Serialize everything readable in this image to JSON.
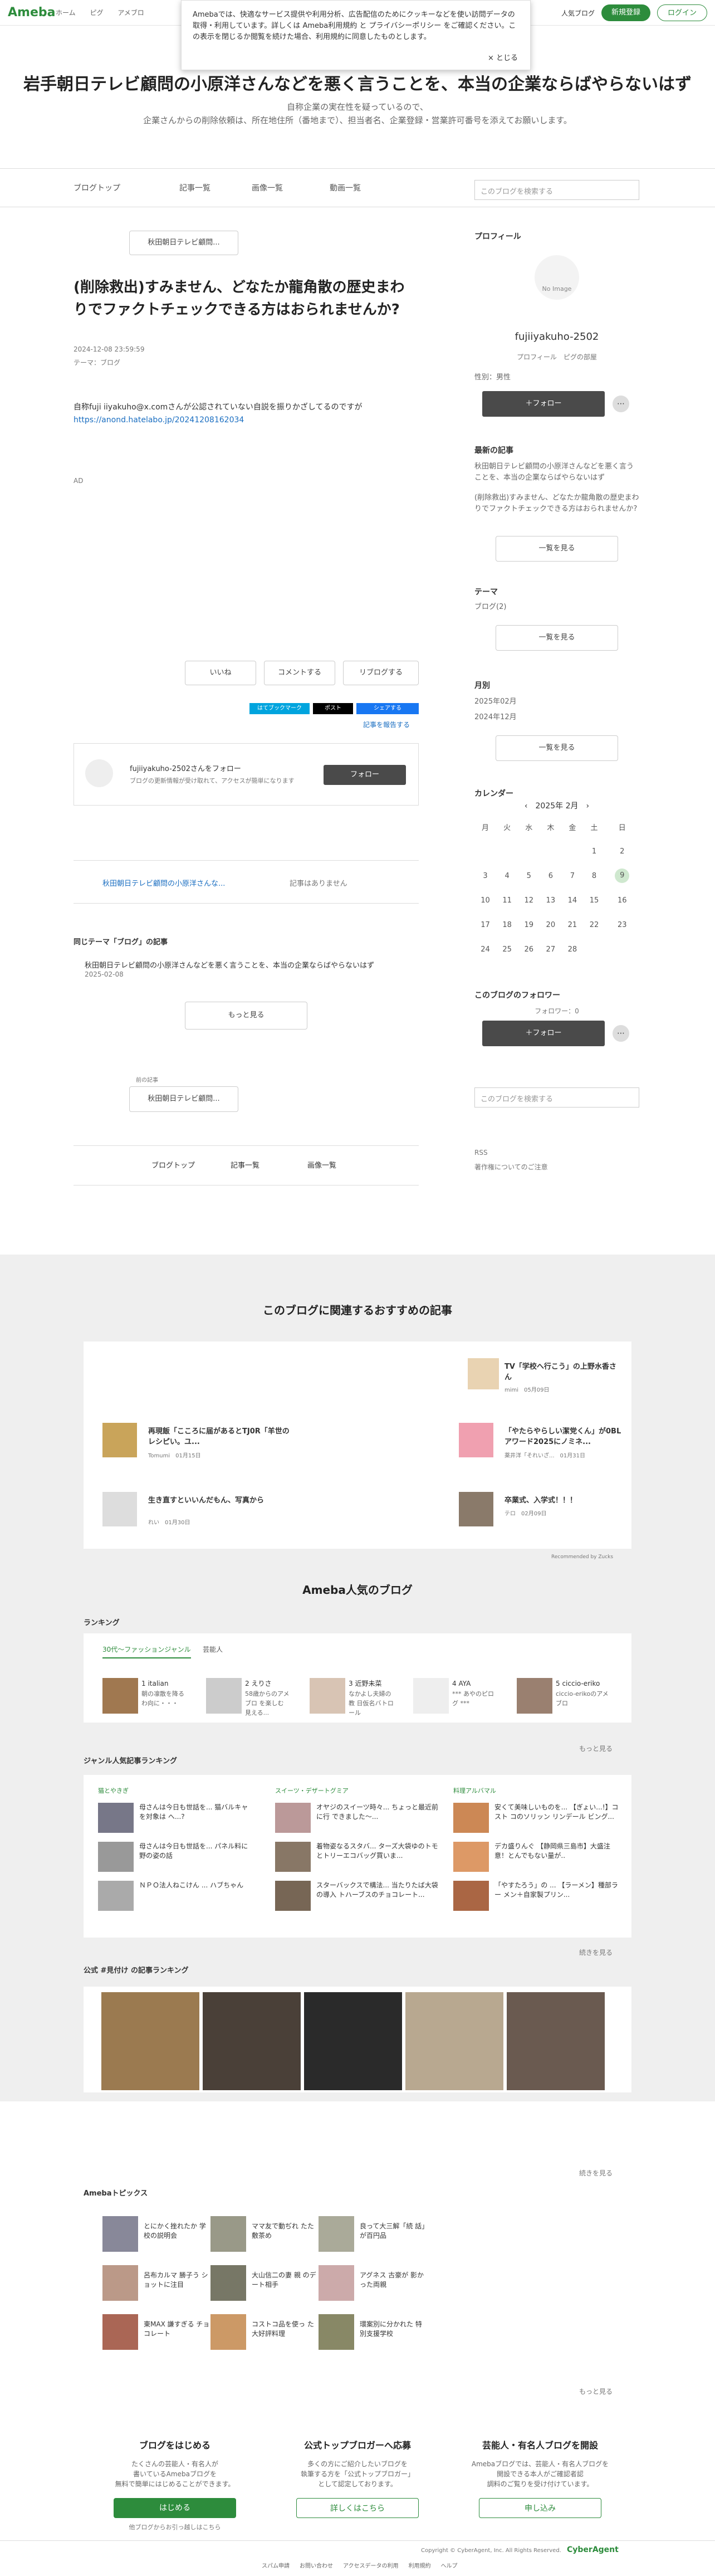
{
  "top": {
    "logo": "Ameba",
    "crumbs": [
      "ホーム",
      "ピグ",
      "アメブロ"
    ],
    "blog_btn": "人気ブログ",
    "register": "新規登録",
    "login": "ログイン"
  },
  "cookie": {
    "text": "Amebaでは、快適なサービス提供や利用分析、広告配信のためにクッキーなどを使い訪問データの取得・利用しています。詳しくは Ameba利用規約 と プライバシーポリシー をご確認ください。この表示を閉じるか閲覧を続けた場合、利用規約に同意したものとします。",
    "close": "× とじる"
  },
  "hero": {
    "title": "岩手朝日テレビ顧問の小原洋さんなどを悪く言うことを、本当の企業ならばやらないはず",
    "desc1": "自称企業の実在性を疑っているので、",
    "desc2": "企業さんからの削除依頼は、所在地住所（番地まで）、担当者名、企業登録・営業許可番号を添えてお願いします。"
  },
  "nav": {
    "tabs": [
      "ブログトップ",
      "記事一覧",
      "画像一覧",
      "動画一覧"
    ],
    "search_placeholder": "このブログを検索する"
  },
  "article": {
    "back": "秋田朝日テレビ顧問...",
    "title": "(削除救出)すみません、どなたか龍角散の歴史まわりでファクトチェックできる方はおられませんか?",
    "date": "2024-12-08 23:59:59",
    "theme": "テーマ：ブログ",
    "body1": "自称fuji iiyakuho@x.comさんが公認されていない自説を振りかざしてるのですが",
    "body2": "https://anond.hatelabo.jp/20241208162034",
    "ad": "AD",
    "like": "いいね",
    "comment": "コメントする",
    "reblog": "リブログする",
    "bookmark_label": "はてブックマーク",
    "post_label": "ポスト",
    "share_label": "シェアする",
    "report": "記事を報告する",
    "follow_name": "fujiiyakuho-2502さんをフォロー",
    "follow_desc": "ブログの更新情報が受け取れて、アクセスが簡単になります",
    "follow_btn": "フォロー",
    "prev": "秋田朝日テレビ顧問の小原洋さんな...",
    "next": "記事はありません",
    "same_theme": "同じテーマ「ブログ」の記事",
    "same_item": "秋田朝日テレビ顧問の小原洋さんなどを悪く言うことを、本当の企業ならばやらないはず",
    "same_date": "2025-02-08",
    "more": "もっと見る",
    "before_label": "前の記事",
    "before_btn": "秋田朝日テレビ顧問...",
    "bottom_tabs": [
      "ブログトップ",
      "記事一覧",
      "画像一覧"
    ]
  },
  "side": {
    "profile": "プロフィール",
    "noimage": "No Image",
    "name": "fujiiyakuho-2502",
    "links": "プロフィール　ピグの部屋",
    "gender": "性別：男性",
    "follow": "＋フォロー",
    "latest": "最新の記事",
    "latest1": "秋田朝日テレビ顧問の小原洋さんなどを悪く言うことを、本当の企業ならばやらないはず",
    "latest2": "(削除救出)すみません、どなたか龍角散の歴史まわりでファクトチェックできる方はおられませんか?",
    "more": "一覧を見る",
    "theme": "テーマ",
    "theme1": "ブログ(2)",
    "month": "月別",
    "month1": "2025年02月",
    "month2": "2024年12月",
    "calendar": "カレンダー",
    "cal_title": "2025年 2月",
    "weekdays": [
      "月",
      "火",
      "水",
      "木",
      "金",
      "土",
      "日"
    ],
    "followers": "このブログのフォロワー",
    "followers_count": "フォロワー：0",
    "rss": "RSS",
    "copyright_note": "著作権についてのご注意"
  },
  "rec": {
    "title": "このブログに関連するおすすめの記事",
    "items": [
      {
        "t": "TV「学校へ行こう」の上野水香さん",
        "m": "mimi　05月09日"
      },
      {
        "t": "再現飯「こころに届があるとTJ0R「羊世のレシピい。ユ...",
        "m": "Tomumi　01月15日"
      },
      {
        "t": "「やたらやらしい潔党くん」が0BLアワード2025にノミネ...",
        "m": "薬井洋「それいざ...　01月31日"
      },
      {
        "t": "生き直すといいんだもん、写真から",
        "m": "れい　01月30日"
      },
      {
        "t": "卒業式、入学式！！！",
        "m": "テロ　02月09日"
      }
    ],
    "credit": "Recommended by Zucks"
  },
  "pop": {
    "title": "Ameba人気のブログ",
    "ranking": "ランキング",
    "tabs": [
      "30代〜ファッションジャンル",
      "芸能人"
    ],
    "people": [
      {
        "n": "1 italian",
        "d": "朝の凛散を降る\nわ向に・・・"
      },
      {
        "n": "2 えりさ",
        "d": "58歳からのアメブロ\nを楽しむ\n見える..."
      },
      {
        "n": "3 近野未菜",
        "d": "なかよし夫婦の教\n日仮名バトロール"
      },
      {
        "n": "4 AYA",
        "d": "*** あやのピロ\nグ ***"
      },
      {
        "n": "5 ciccio-eriko",
        "d": "ciccio-erikoのアメ\nブロ"
      }
    ],
    "more": "もっと見る",
    "genre": "ジャンル人気記事ランキング",
    "cols": [
      {
        "h": "猫とやきぎ",
        "items": [
          "母さんは今日も世話を...\n猫バルキャを対象は\nへ...?",
          "母さんは今日も世話を...\nパネル料に野の姿の話",
          "ＮＰＯ法人ねこけん ...\nハブちゃん"
        ]
      },
      {
        "h": "スイーツ・デザートグミア",
        "items": [
          "オヤジのスイーツ時々...\nちょっと最近前に行\nできました〜...",
          "着物姿なるスタバ...\nターズ大袋ゆのトモ\nとトリーエコバッグ買いま...",
          "スターバックスで構法...\n当たりたば大袋の導入\nトハーブスのチョコレート..."
        ]
      },
      {
        "h": "料理アルバマル",
        "items": [
          "安くて美味しいものを...\n【ぎょい...!】コスト\nコのソリッン リンデール ビング...",
          "デカ盛りんぐ\n【静岡県三島市】大盛注\n意！とんでもない量が..",
          "「やすたろう」の ...\n【ラーメン】種部ラー\nメン＋自家製プリン..."
        ]
      }
    ],
    "more2": "続きを見る",
    "official": "公式 #見付け の記事ランキング",
    "more3": "続きを見る"
  },
  "topics": {
    "title": "Amebaトピックス",
    "items": [
      {
        "t": "とにかく挫れたか\n学校の説明会"
      },
      {
        "t": "ママ友で動ぢれ\nたた敷茶め"
      },
      {
        "t": "良って大三解「続\n話」が百円品"
      },
      {
        "t": "呂布カルマ 勝子う\nショットに注目"
      },
      {
        "t": "大山信二の妻 親\nのデート相手"
      },
      {
        "t": "アグネス 古豪が\n影かった両親"
      },
      {
        "t": "東MAX 謙すぎる\nチョコレート"
      },
      {
        "t": "コストコ品を使っ\nた大好評料理"
      },
      {
        "t": "環案別に分かれた\n特別支援学校"
      }
    ],
    "more": "もっと見る"
  },
  "footer": {
    "c1h": "ブログをはじめる",
    "c1p": "たくさんの芸能人・有名人が\n書いているAmebaブログを\n無料で簡単にはじめることができます。",
    "c1b": "はじめる",
    "c1s": "他ブログからお引っ越しはこちら",
    "c2h": "公式トップブロガーへ応募",
    "c2p": "多くの方にご紹介したいブログを\n執筆する方を「公式トップブロガー」\nとして認定しております。",
    "c2b": "詳しくはこちら",
    "c3h": "芸能人・有名人ブログを開設",
    "c3p": "Amebaブログでは、芸能人・有名人ブログを\n開設できる本人がご確認者認\n調料のご覧りを受け付けています。",
    "c3b": "申し込み",
    "copyright": "Copyright © CyberAgent, Inc. All Rights Reserved.",
    "ca": "CyberAgent",
    "links": [
      "スパム申請",
      "お問い合わせ",
      "アクセスデータの利用",
      "利用規約",
      "ヘルプ"
    ]
  }
}
